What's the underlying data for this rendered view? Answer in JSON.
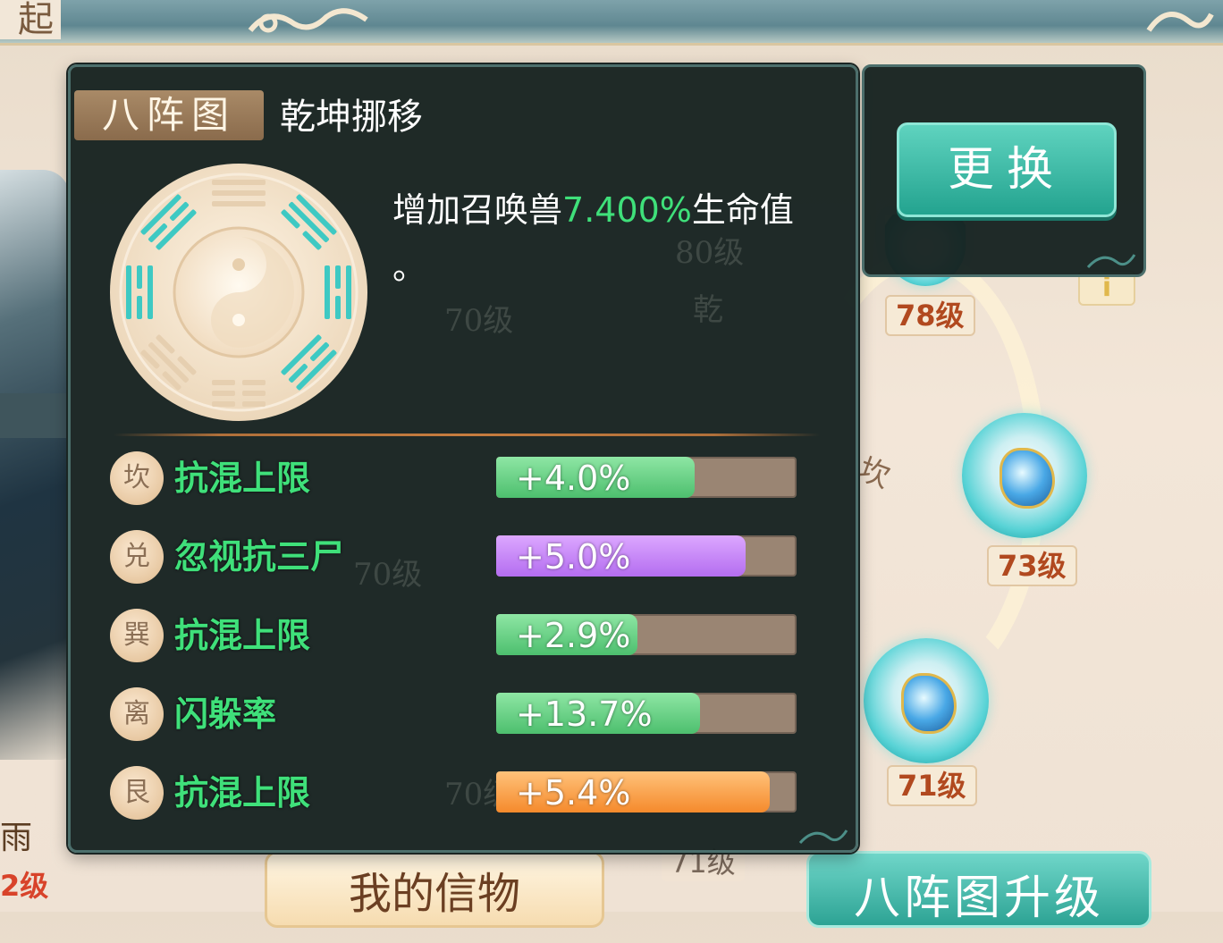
{
  "background": {
    "left_character_name": "雨",
    "left_character_level": "2级",
    "top_banner_caption": "起",
    "trigram_label": "坎",
    "orbs": [
      {
        "level": "78级"
      },
      {
        "level": "73级"
      },
      {
        "level": "71级"
      }
    ],
    "ghost_labels": [
      "80级",
      "70级",
      "乾",
      "70级",
      "70级"
    ],
    "bottom_ghost_level": "71级",
    "my_token_button": "我的信物",
    "upgrade_button": "八阵图升级",
    "info_tag": "i"
  },
  "panel": {
    "badge": "八阵图",
    "formation_name": "乾坤挪移",
    "description_prefix": "增加召唤兽",
    "description_value": "7.400%",
    "description_suffix": "生命值",
    "description_end": "。",
    "stats": [
      {
        "trigram": "坎",
        "name": "抗混上限",
        "value": "+4.0%",
        "fill": 0.66,
        "color": "green"
      },
      {
        "trigram": "兑",
        "name": "忽视抗三尸",
        "value": "+5.0%",
        "fill": 0.83,
        "color": "purple"
      },
      {
        "trigram": "巽",
        "name": "抗混上限",
        "value": "+2.9%",
        "fill": 0.47,
        "color": "green"
      },
      {
        "trigram": "离",
        "name": "闪躲率",
        "value": "+13.7%",
        "fill": 0.68,
        "color": "green"
      },
      {
        "trigram": "艮",
        "name": "抗混上限",
        "value": "+5.4%",
        "fill": 0.91,
        "color": "orange"
      }
    ]
  },
  "side": {
    "change_button": "更换"
  },
  "colors": {
    "accent_green": "#3fe07a",
    "panel_bg": "#162220",
    "button_teal": "#23a38f"
  }
}
